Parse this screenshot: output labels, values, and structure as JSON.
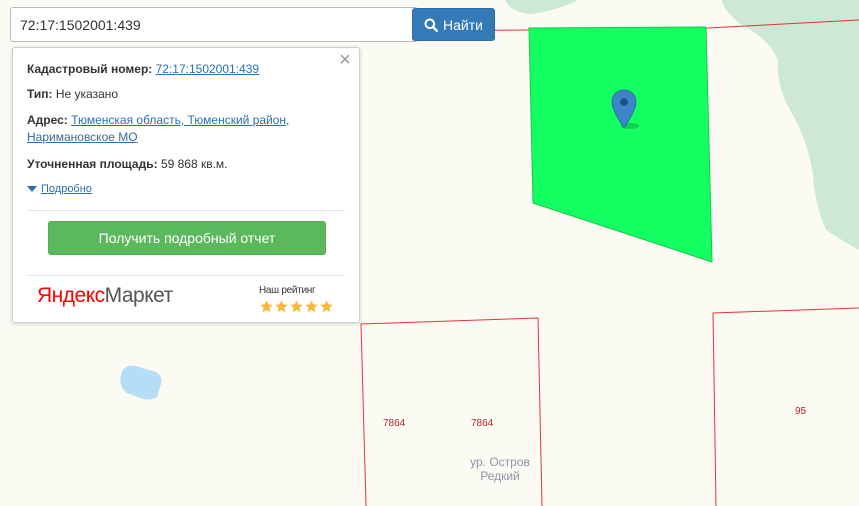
{
  "search": {
    "value": "72:17:1502001:439",
    "button_label": "Найти"
  },
  "popup": {
    "close_glyph": "×",
    "cadastral_label": "Кадастровый номер:",
    "cadastral_value": "72:17:1502001:439",
    "type_label": "Тип:",
    "type_value": "Не указано",
    "address_label": "Адрес:",
    "address_line1": "Тюменская область, Тюменский район,",
    "address_line2": "Наримановское МО",
    "area_label": "Уточненная площадь:",
    "area_value": "59 868 кв.м.",
    "details_label": "Подробно",
    "report_button_label": "Получить подробный отчет",
    "market_logo_ya": "Яндекс",
    "market_logo_market": "Маркет",
    "rating_label": "Наш рейтинг",
    "rating_stars": 5,
    "star_color": "#f6b93b"
  },
  "map": {
    "parcel_labels": [
      "7864",
      "7864",
      "95"
    ],
    "place_label_line1": "ур. Остров",
    "place_label_line2": "Редкий",
    "parcel_fill_color": "#14ff62",
    "boundary_color": "#e0333a",
    "forest_color": "#cde8d6",
    "water_color": "#b5def6",
    "marker_color": "#3d85c6"
  }
}
